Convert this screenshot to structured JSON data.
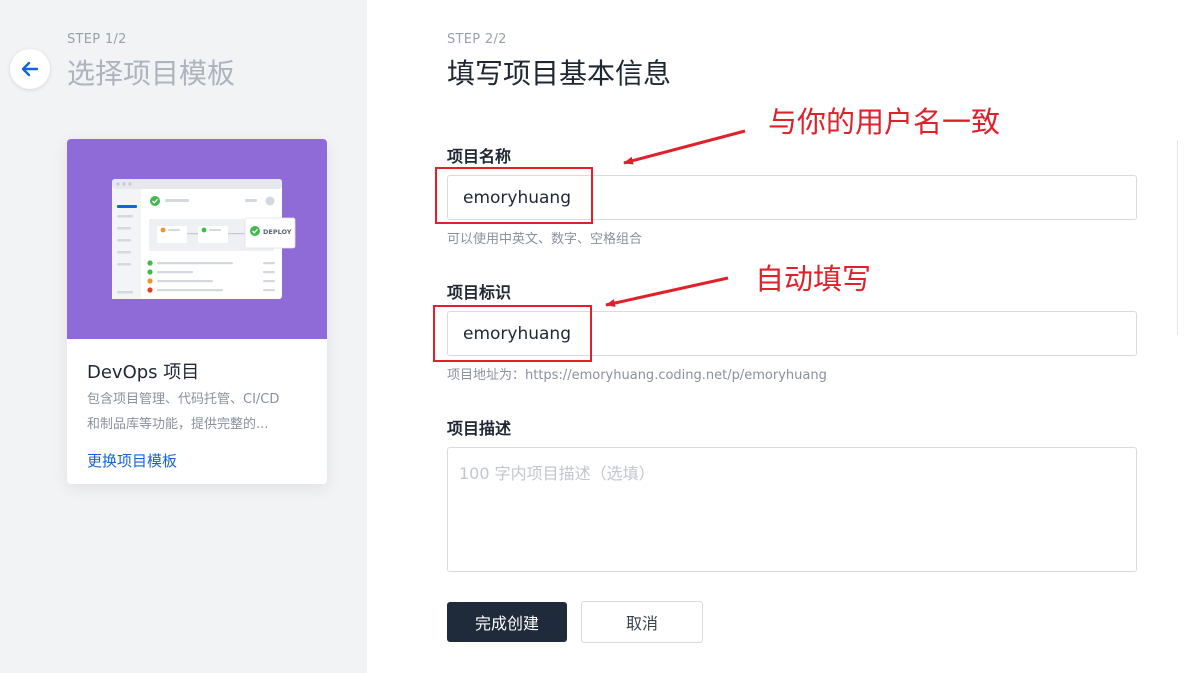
{
  "left": {
    "step": "STEP 1/2",
    "title": "选择项目模板",
    "template": {
      "name": "DevOps 项目",
      "desc_line1": "包含项目管理、代码托管、CI/CD",
      "desc_line2": "和制品库等功能，提供完整的...",
      "change_link": "更换项目模板",
      "deploy_label": "DEPLOY"
    }
  },
  "form": {
    "step": "STEP 2/2",
    "title": "填写项目基本信息",
    "name_label": "项目名称",
    "name_value": "emoryhuang",
    "name_hint": "可以使用中英文、数字、空格组合",
    "id_label": "项目标识",
    "id_value": "emoryhuang",
    "id_hint": "项目地址为：https://emoryhuang.coding.net/p/emoryhuang",
    "desc_label": "项目描述",
    "desc_placeholder": "100 字内项目描述（选填）",
    "submit_label": "完成创建",
    "cancel_label": "取消"
  },
  "annotations": {
    "name_note": "与你的用户名一致",
    "id_note": "自动填写"
  },
  "colors": {
    "banner": "#8e6bd6",
    "primary_button": "#1f2a3a",
    "link": "#1565d8",
    "annotation": "#e0202a"
  }
}
